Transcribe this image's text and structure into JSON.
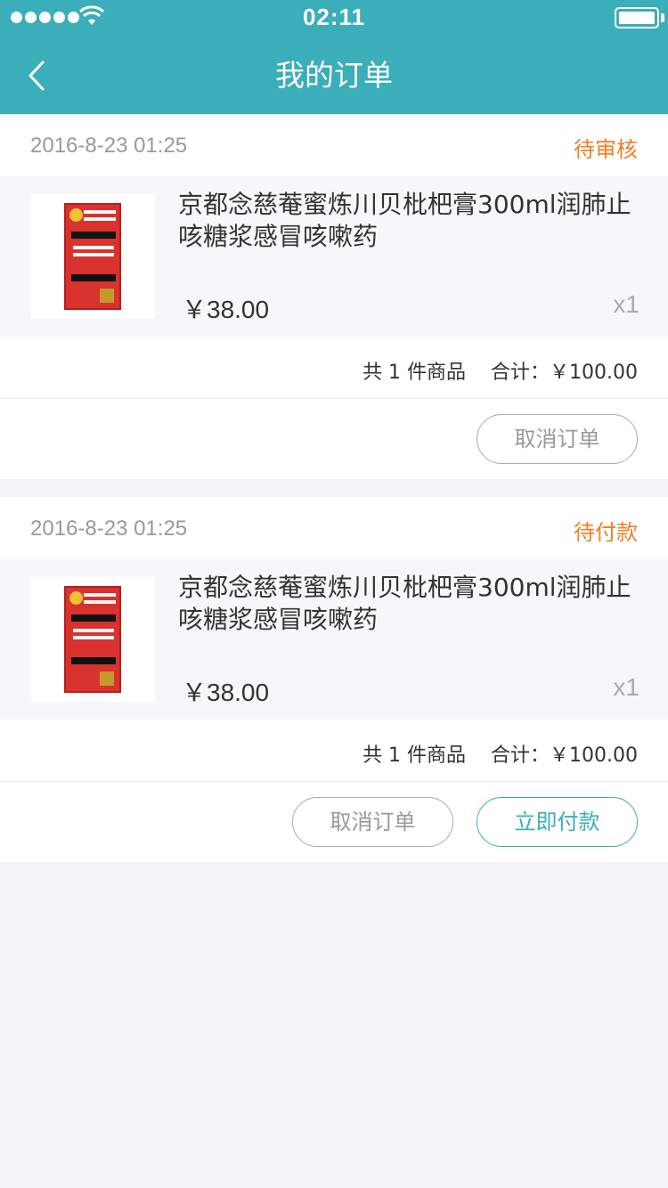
{
  "status_bar": {
    "time": "02:11"
  },
  "header": {
    "title": "我的订单",
    "back_icon": "chevron-left-icon"
  },
  "colors": {
    "primary": "#3aaeb9",
    "status_orange": "#f07e22"
  },
  "orders": [
    {
      "date": "2016-8-23  01:25",
      "status": "待审核",
      "product": {
        "name": "京都念慈菴蜜炼川贝枇杷膏300ml润肺止咳糖浆感冒咳嗽药",
        "price": "￥38.00",
        "qty": "x1"
      },
      "summary": "共 1 件商品    合计：￥100.00",
      "actions": {
        "cancel": "取消订单"
      }
    },
    {
      "date": "2016-8-23  01:25",
      "status": "待付款",
      "product": {
        "name": "京都念慈菴蜜炼川贝枇杷膏300ml润肺止咳糖浆感冒咳嗽药",
        "price": "￥38.00",
        "qty": "x1"
      },
      "summary": "共 1 件商品    合计：￥100.00",
      "actions": {
        "cancel": "取消订单",
        "pay": "立即付款"
      }
    }
  ]
}
